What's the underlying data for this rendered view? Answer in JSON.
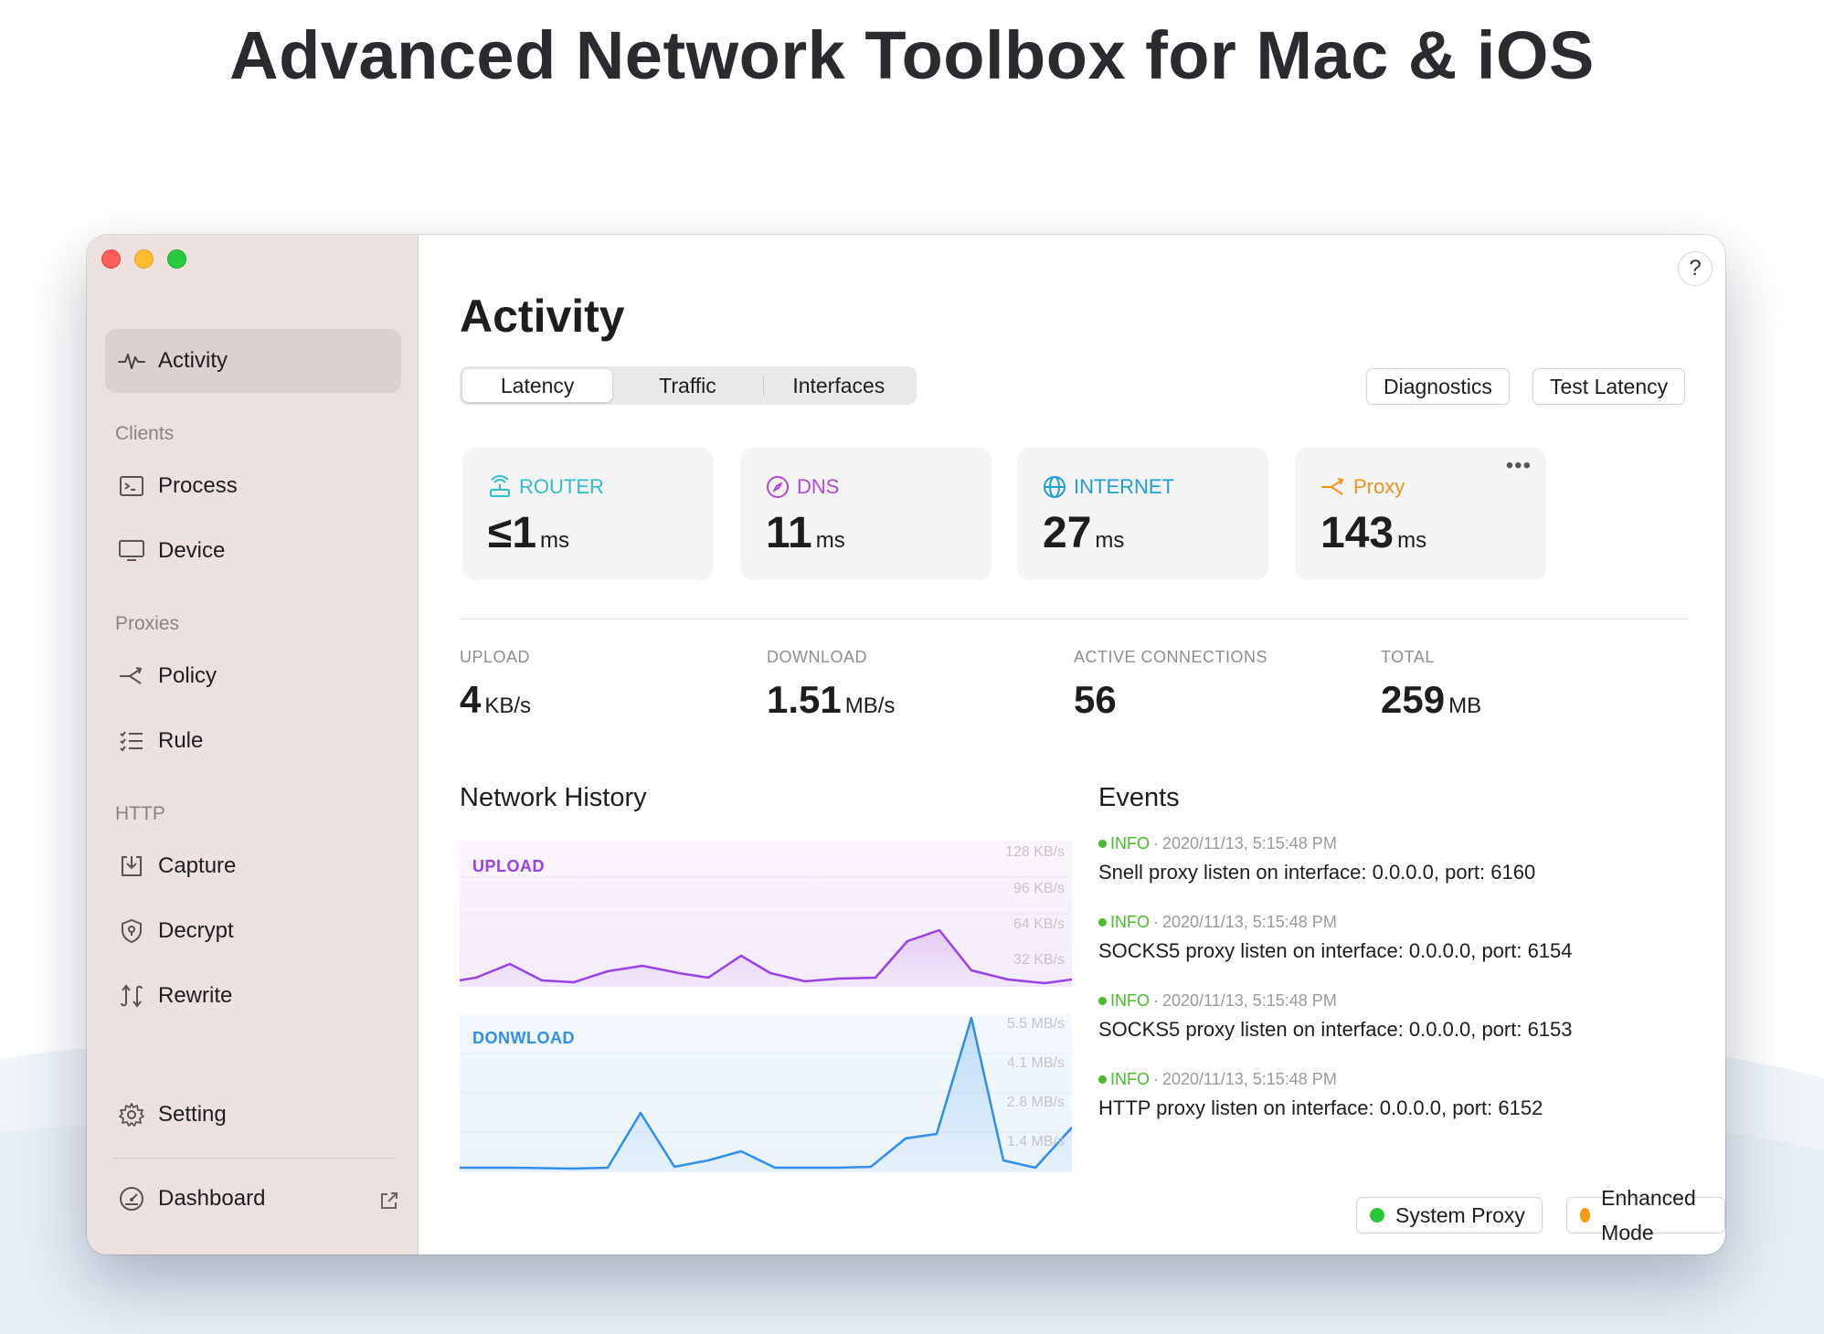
{
  "headline": "Advanced Network Toolbox for Mac & iOS",
  "sidebar": {
    "activity": "Activity",
    "sections": {
      "clients": "Clients",
      "proxies": "Proxies",
      "http": "HTTP"
    },
    "items": {
      "process": "Process",
      "device": "Device",
      "policy": "Policy",
      "rule": "Rule",
      "capture": "Capture",
      "decrypt": "Decrypt",
      "rewrite": "Rewrite",
      "setting": "Setting",
      "dashboard": "Dashboard"
    }
  },
  "main": {
    "help": "?",
    "title": "Activity",
    "tabs": [
      "Latency",
      "Traffic",
      "Interfaces"
    ],
    "buttons": {
      "diagnostics": "Diagnostics",
      "test_latency": "Test Latency"
    },
    "latency_cards": [
      {
        "name": "ROUTER",
        "value": "≤1",
        "unit": "ms",
        "color": "#2fbfc9"
      },
      {
        "name": "DNS",
        "value": "11",
        "unit": "ms",
        "color": "#b149d6"
      },
      {
        "name": "INTERNET",
        "value": "27",
        "unit": "ms",
        "color": "#1e9fd8"
      },
      {
        "name": "Proxy",
        "value": "143",
        "unit": "ms",
        "color": "#f5921e",
        "more": "•••"
      }
    ],
    "stats": [
      {
        "label": "UPLOAD",
        "value": "4",
        "unit": "KB/s"
      },
      {
        "label": "DOWNLOAD",
        "value": "1.51",
        "unit": "MB/s"
      },
      {
        "label": "ACTIVE CONNECTIONS",
        "value": "56",
        "unit": ""
      },
      {
        "label": "TOTAL",
        "value": "259",
        "unit": "MB"
      }
    ],
    "network_history": {
      "title": "Network History",
      "upload": {
        "label": "UPLOAD",
        "color": "#9b3fe6",
        "ticks": [
          "128 KB/s",
          "96 KB/s",
          "64 KB/s",
          "32 KB/s"
        ]
      },
      "download": {
        "label": "DONWLOAD",
        "color": "#2e8ff0",
        "ticks": [
          "5.5 MB/s",
          "4.1 MB/s",
          "2.8 MB/s",
          "1.4 MB/s"
        ]
      }
    },
    "events": {
      "title": "Events",
      "items": [
        {
          "level": "INFO",
          "time": "2020/11/13, 5:15:48 PM",
          "message": "Snell proxy listen on interface: 0.0.0.0, port: 6160"
        },
        {
          "level": "INFO",
          "time": "2020/11/13, 5:15:48 PM",
          "message": "SOCKS5 proxy listen on interface: 0.0.0.0, port: 6154"
        },
        {
          "level": "INFO",
          "time": "2020/11/13, 5:15:48 PM",
          "message": "SOCKS5 proxy listen on interface: 0.0.0.0, port: 6153"
        },
        {
          "level": "INFO",
          "time": "2020/11/13, 5:15:48 PM",
          "message": "HTTP proxy listen on interface: 0.0.0.0, port: 6152"
        }
      ]
    },
    "status": {
      "system_proxy": {
        "label": "System Proxy",
        "color": "#2cc63b"
      },
      "enhanced_mode": {
        "label": "Enhanced Mode",
        "color": "#fb9a0f"
      }
    }
  }
}
